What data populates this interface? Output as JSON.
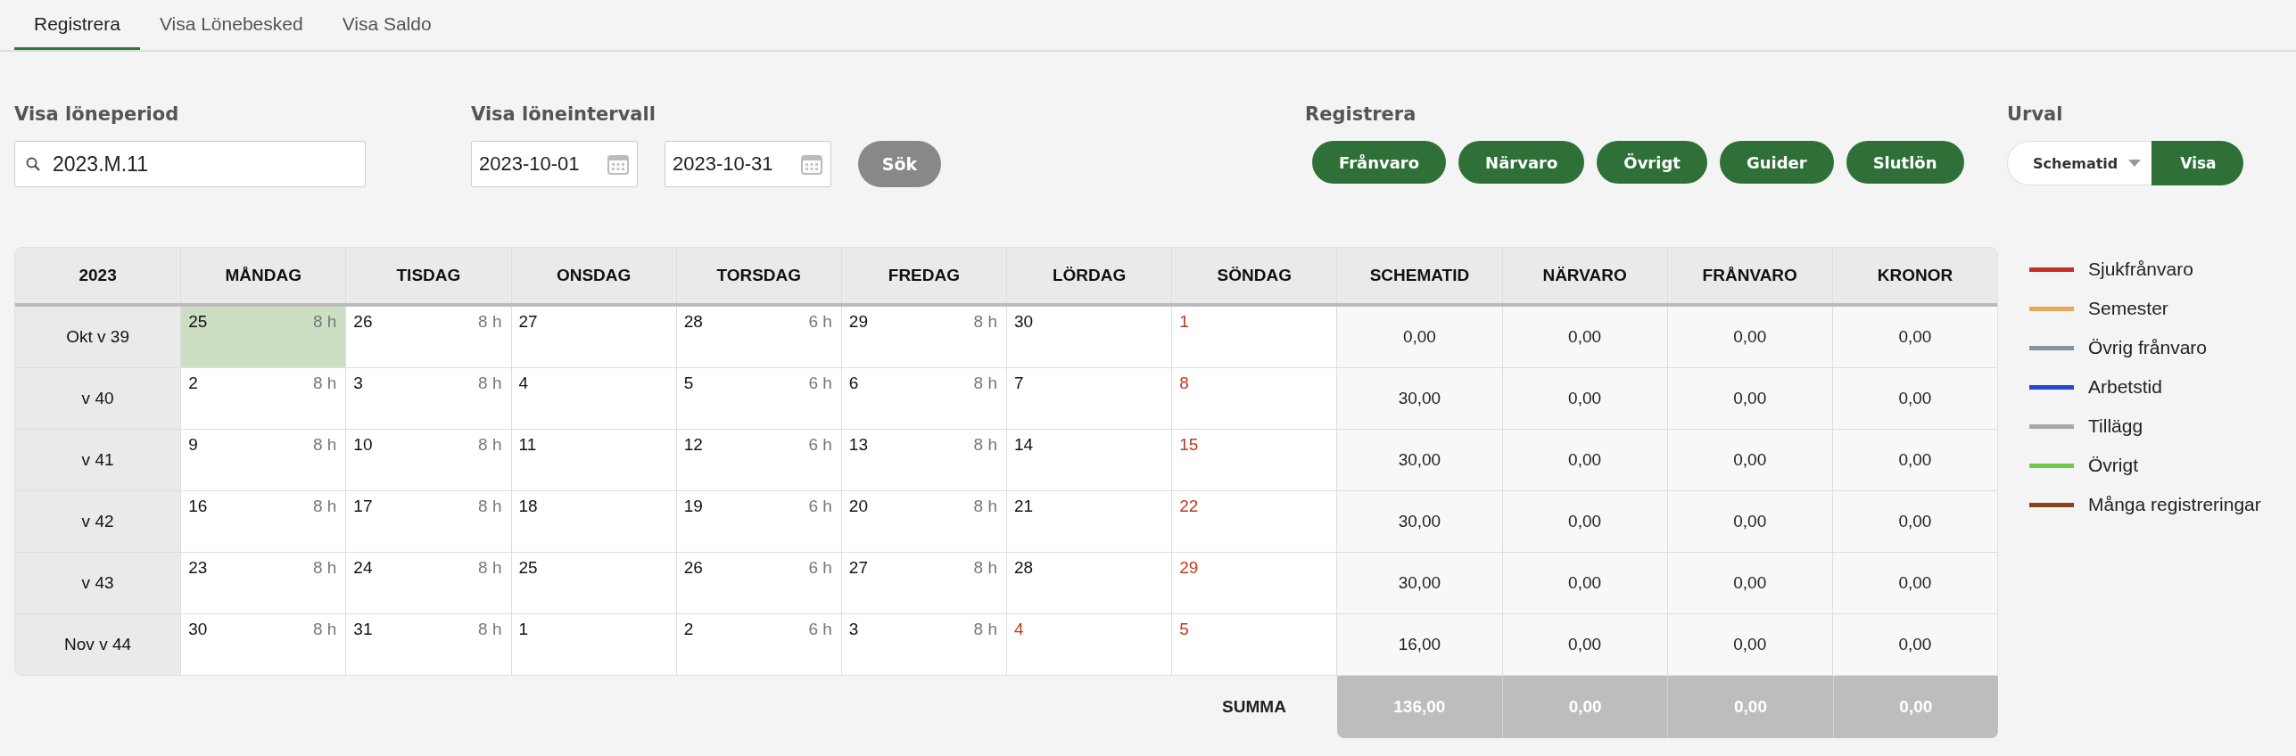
{
  "tabs": [
    {
      "label": "Registrera",
      "selected": true
    },
    {
      "label": "Visa Lönebesked",
      "selected": false
    },
    {
      "label": "Visa Saldo",
      "selected": false
    }
  ],
  "period": {
    "label": "Visa löneperiod",
    "value": "2023.M.11"
  },
  "interval": {
    "label": "Visa löneintervall",
    "from": "2023-10-01",
    "to": "2023-10-31",
    "button": "Sök"
  },
  "register": {
    "label": "Registrera",
    "buttons": [
      "Frånvaro",
      "Närvaro",
      "Övrigt",
      "Guider",
      "Slutlön"
    ]
  },
  "selection": {
    "label": "Urval",
    "value": "Schematid",
    "button": "Visa"
  },
  "table": {
    "columns": [
      "2023",
      "MÅNDAG",
      "TISDAG",
      "ONSDAG",
      "TORSDAG",
      "FREDAG",
      "LÖRDAG",
      "SÖNDAG",
      "SCHEMATID",
      "NÄRVARO",
      "FRÅNVARO",
      "KRONOR"
    ],
    "rows": [
      {
        "week": "Okt v 39",
        "days": [
          {
            "day": "25",
            "hours": "8 h",
            "holiday": false,
            "selected": true
          },
          {
            "day": "26",
            "hours": "8 h",
            "holiday": false,
            "selected": false
          },
          {
            "day": "27",
            "holiday": false,
            "selected": false
          },
          {
            "day": "28",
            "hours": "6 h",
            "holiday": false,
            "selected": false
          },
          {
            "day": "29",
            "hours": "8 h",
            "holiday": false,
            "selected": false
          },
          {
            "day": "30",
            "holiday": false,
            "selected": false
          },
          {
            "day": "1",
            "holiday": true,
            "selected": false
          }
        ],
        "totals": [
          "0,00",
          "0,00",
          "0,00",
          "0,00"
        ]
      },
      {
        "week": "v 40",
        "days": [
          {
            "day": "2",
            "hours": "8 h",
            "holiday": false,
            "selected": false
          },
          {
            "day": "3",
            "hours": "8 h",
            "holiday": false,
            "selected": false
          },
          {
            "day": "4",
            "holiday": false,
            "selected": false
          },
          {
            "day": "5",
            "hours": "6 h",
            "holiday": false,
            "selected": false
          },
          {
            "day": "6",
            "hours": "8 h",
            "holiday": false,
            "selected": false
          },
          {
            "day": "7",
            "holiday": false,
            "selected": false
          },
          {
            "day": "8",
            "holiday": true,
            "selected": false
          }
        ],
        "totals": [
          "30,00",
          "0,00",
          "0,00",
          "0,00"
        ]
      },
      {
        "week": "v 41",
        "days": [
          {
            "day": "9",
            "hours": "8 h",
            "holiday": false,
            "selected": false
          },
          {
            "day": "10",
            "hours": "8 h",
            "holiday": false,
            "selected": false
          },
          {
            "day": "11",
            "holiday": false,
            "selected": false
          },
          {
            "day": "12",
            "hours": "6 h",
            "holiday": false,
            "selected": false
          },
          {
            "day": "13",
            "hours": "8 h",
            "holiday": false,
            "selected": false
          },
          {
            "day": "14",
            "holiday": false,
            "selected": false
          },
          {
            "day": "15",
            "holiday": true,
            "selected": false
          }
        ],
        "totals": [
          "30,00",
          "0,00",
          "0,00",
          "0,00"
        ]
      },
      {
        "week": "v 42",
        "days": [
          {
            "day": "16",
            "hours": "8 h",
            "holiday": false,
            "selected": false
          },
          {
            "day": "17",
            "hours": "8 h",
            "holiday": false,
            "selected": false
          },
          {
            "day": "18",
            "holiday": false,
            "selected": false
          },
          {
            "day": "19",
            "hours": "6 h",
            "holiday": false,
            "selected": false
          },
          {
            "day": "20",
            "hours": "8 h",
            "holiday": false,
            "selected": false
          },
          {
            "day": "21",
            "holiday": false,
            "selected": false
          },
          {
            "day": "22",
            "holiday": true,
            "selected": false
          }
        ],
        "totals": [
          "30,00",
          "0,00",
          "0,00",
          "0,00"
        ]
      },
      {
        "week": "v 43",
        "days": [
          {
            "day": "23",
            "hours": "8 h",
            "holiday": false,
            "selected": false
          },
          {
            "day": "24",
            "hours": "8 h",
            "holiday": false,
            "selected": false
          },
          {
            "day": "25",
            "holiday": false,
            "selected": false
          },
          {
            "day": "26",
            "hours": "6 h",
            "holiday": false,
            "selected": false
          },
          {
            "day": "27",
            "hours": "8 h",
            "holiday": false,
            "selected": false
          },
          {
            "day": "28",
            "holiday": false,
            "selected": false
          },
          {
            "day": "29",
            "holiday": true,
            "selected": false
          }
        ],
        "totals": [
          "30,00",
          "0,00",
          "0,00",
          "0,00"
        ]
      },
      {
        "week": "Nov v 44",
        "days": [
          {
            "day": "30",
            "hours": "8 h",
            "holiday": false,
            "selected": false
          },
          {
            "day": "31",
            "hours": "8 h",
            "holiday": false,
            "selected": false
          },
          {
            "day": "1",
            "holiday": false,
            "selected": false
          },
          {
            "day": "2",
            "hours": "6 h",
            "holiday": false,
            "selected": false
          },
          {
            "day": "3",
            "hours": "8 h",
            "holiday": false,
            "selected": false
          },
          {
            "day": "4",
            "holiday": true,
            "selected": false
          },
          {
            "day": "5",
            "holiday": true,
            "selected": false
          }
        ],
        "totals": [
          "16,00",
          "0,00",
          "0,00",
          "0,00"
        ]
      }
    ],
    "sum_label": "SUMMA",
    "sums": [
      "136,00",
      "0,00",
      "0,00",
      "0,00"
    ]
  },
  "legend": [
    {
      "label": "Sjukfrånvaro",
      "color": "#c8302a"
    },
    {
      "label": "Semester",
      "color": "#e8a85c"
    },
    {
      "label": "Övrig frånvaro",
      "color": "#8892a0"
    },
    {
      "label": "Arbetstid",
      "color": "#2a45d0"
    },
    {
      "label": "Tillägg",
      "color": "#a8a6aa"
    },
    {
      "label": "Övrigt",
      "color": "#6cc94a"
    },
    {
      "label": "Många registreringar",
      "color": "#86441c"
    }
  ]
}
